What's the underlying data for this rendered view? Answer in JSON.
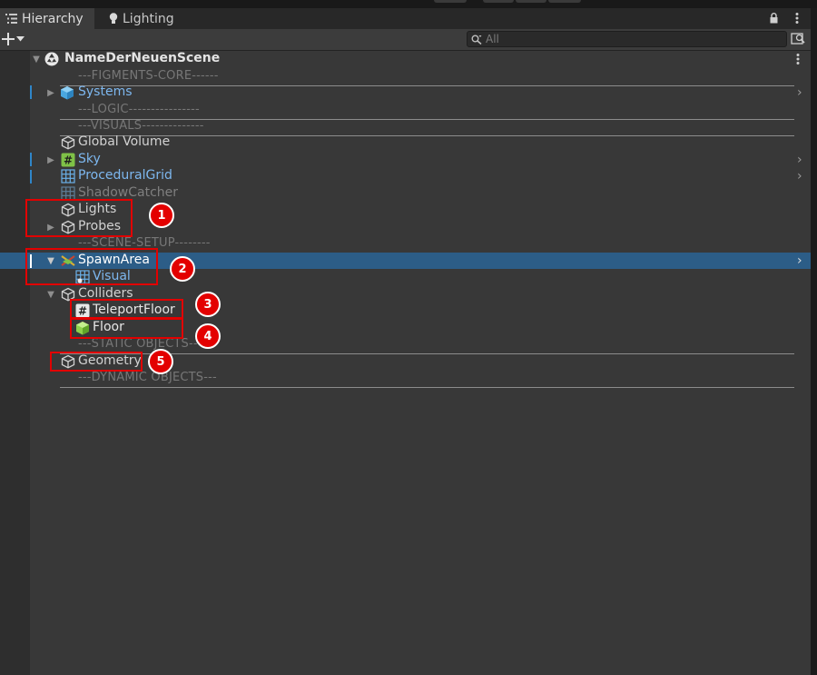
{
  "tabs": [
    {
      "label": "Hierarchy",
      "icon": "list-icon"
    },
    {
      "label": "Lighting",
      "icon": "lightbulb-icon"
    }
  ],
  "search": {
    "placeholder": "All"
  },
  "scene": {
    "name": "NameDerNeuenScene"
  },
  "rows": [
    {
      "label": "---FIGMENTS-CORE------"
    },
    {
      "label": "Systems"
    },
    {
      "label": "---LOGIC----------------"
    },
    {
      "label": "---VISUALS--------------"
    },
    {
      "label": "Global Volume"
    },
    {
      "label": "Sky"
    },
    {
      "label": "ProceduralGrid"
    },
    {
      "label": "ShadowCatcher"
    },
    {
      "label": "Lights"
    },
    {
      "label": "Probes"
    },
    {
      "label": "---SCENE-SETUP--------"
    },
    {
      "label": "SpawnArea"
    },
    {
      "label": "Visual"
    },
    {
      "label": "Colliders"
    },
    {
      "label": "TeleportFloor"
    },
    {
      "label": "Floor"
    },
    {
      "label": "---STATIC OBJECTS------"
    },
    {
      "label": "Geometry"
    },
    {
      "label": "---DYNAMIC OBJECTS---"
    }
  ],
  "annotations": [
    "1",
    "2",
    "3",
    "4",
    "5"
  ],
  "colors": {
    "selection": "#2c5d87",
    "prefab_text": "#7db7ef",
    "highlight": "#e20000",
    "change_marker": "#2f86c9"
  }
}
